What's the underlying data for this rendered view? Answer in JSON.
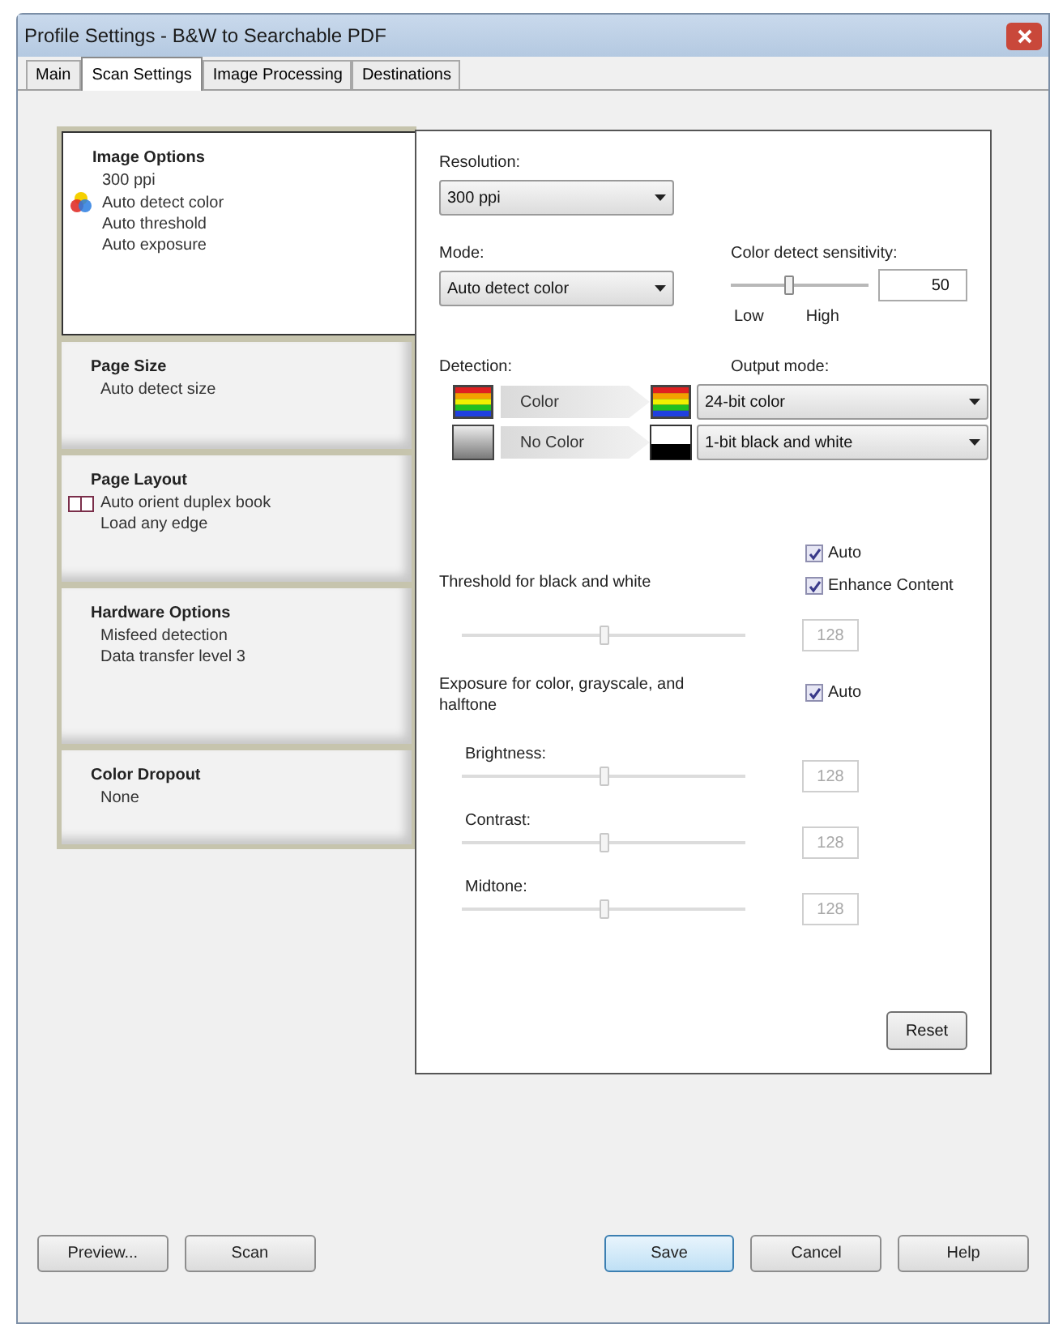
{
  "window": {
    "title": "Profile Settings - B&W to Searchable PDF"
  },
  "tabs": [
    {
      "label": "Main",
      "selected": false
    },
    {
      "label": "Scan Settings",
      "selected": true
    },
    {
      "label": "Image Processing",
      "selected": false
    },
    {
      "label": "Destinations",
      "selected": false
    }
  ],
  "sidebar": {
    "items": [
      {
        "kind": "image",
        "title": "Image Options",
        "lines": [
          "300 ppi",
          "Auto detect color",
          "Auto threshold",
          "Auto exposure"
        ],
        "selected": true
      },
      {
        "kind": "size",
        "title": "Page Size",
        "lines": [
          "Auto detect size"
        ],
        "selected": false
      },
      {
        "kind": "layout",
        "title": "Page Layout",
        "lines": [
          "Auto orient duplex book",
          "Load any edge"
        ],
        "selected": false
      },
      {
        "kind": "hardware",
        "title": "Hardware Options",
        "lines": [
          "Misfeed detection",
          "Data transfer level 3"
        ],
        "selected": false
      },
      {
        "kind": "dropout",
        "title": "Color Dropout",
        "lines": [
          "None"
        ],
        "selected": false
      }
    ]
  },
  "resolution": {
    "label": "Resolution:",
    "value": "300 ppi"
  },
  "mode": {
    "label": "Mode:",
    "value": "Auto detect color"
  },
  "sensitivity": {
    "label": "Color detect sensitivity:",
    "level": 0.42,
    "value": "50",
    "low": "Low",
    "high": "High"
  },
  "detection": {
    "label": "Detection:",
    "output_label": "Output mode:",
    "rows": [
      {
        "kind": "color",
        "label": "Color",
        "output": "24-bit color"
      },
      {
        "kind": "mono",
        "label": "No Color",
        "output": "1-bit black and white"
      }
    ]
  },
  "threshold": {
    "label": "Threshold for black and white",
    "auto": {
      "label": "Auto",
      "checked": true
    },
    "enhance": {
      "label": "Enhance Content",
      "checked": true
    },
    "level": 0.5,
    "value": "128",
    "disabled": true
  },
  "exposure": {
    "label": "Exposure for color, grayscale, and halftone",
    "auto": {
      "label": "Auto",
      "checked": true
    },
    "sliders": [
      {
        "label": "Brightness:",
        "level": 0.5,
        "value": "128",
        "disabled": true
      },
      {
        "label": "Contrast:",
        "level": 0.5,
        "value": "128",
        "disabled": true
      },
      {
        "label": "Midtone:",
        "level": 0.5,
        "value": "128",
        "disabled": true
      }
    ]
  },
  "reset_button": "Reset",
  "buttons": [
    {
      "label": "Preview...",
      "default": false
    },
    {
      "label": "Scan",
      "default": false
    },
    {
      "label": "Save",
      "default": true
    },
    {
      "label": "Cancel",
      "default": false
    },
    {
      "label": "Help",
      "default": false
    }
  ]
}
